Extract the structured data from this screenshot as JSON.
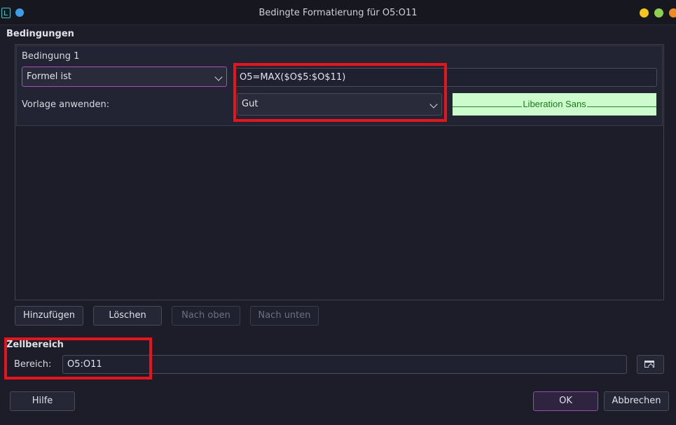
{
  "window": {
    "title": "Bedingte Formatierung für O5:O11"
  },
  "conditions_section": {
    "label": "Bedingungen"
  },
  "condition": {
    "label": "Bedingung 1",
    "type_selected": "Formel ist",
    "formula": "O5=MAX($O$5:$O$11)",
    "apply_style_label": "Vorlage anwenden:",
    "style_selected": "Gut",
    "preview_text": "Liberation Sans"
  },
  "actions": {
    "add": "Hinzufügen",
    "delete": "Löschen",
    "up": "Nach oben",
    "down": "Nach unten"
  },
  "range_section": {
    "label": "Zellbereich",
    "range_label": "Bereich:",
    "range_value": "O5:O11"
  },
  "footer": {
    "help": "Hilfe",
    "ok": "OK",
    "cancel": "Abbrechen"
  },
  "colors": {
    "accent": "#b04ac0",
    "highlight_box": "#e8141c",
    "preview_background": "#ccfccc",
    "preview_text": "#1a7a1a"
  },
  "icons": [
    "app-icon",
    "chevron-down-icon",
    "shrink-range-icon"
  ]
}
